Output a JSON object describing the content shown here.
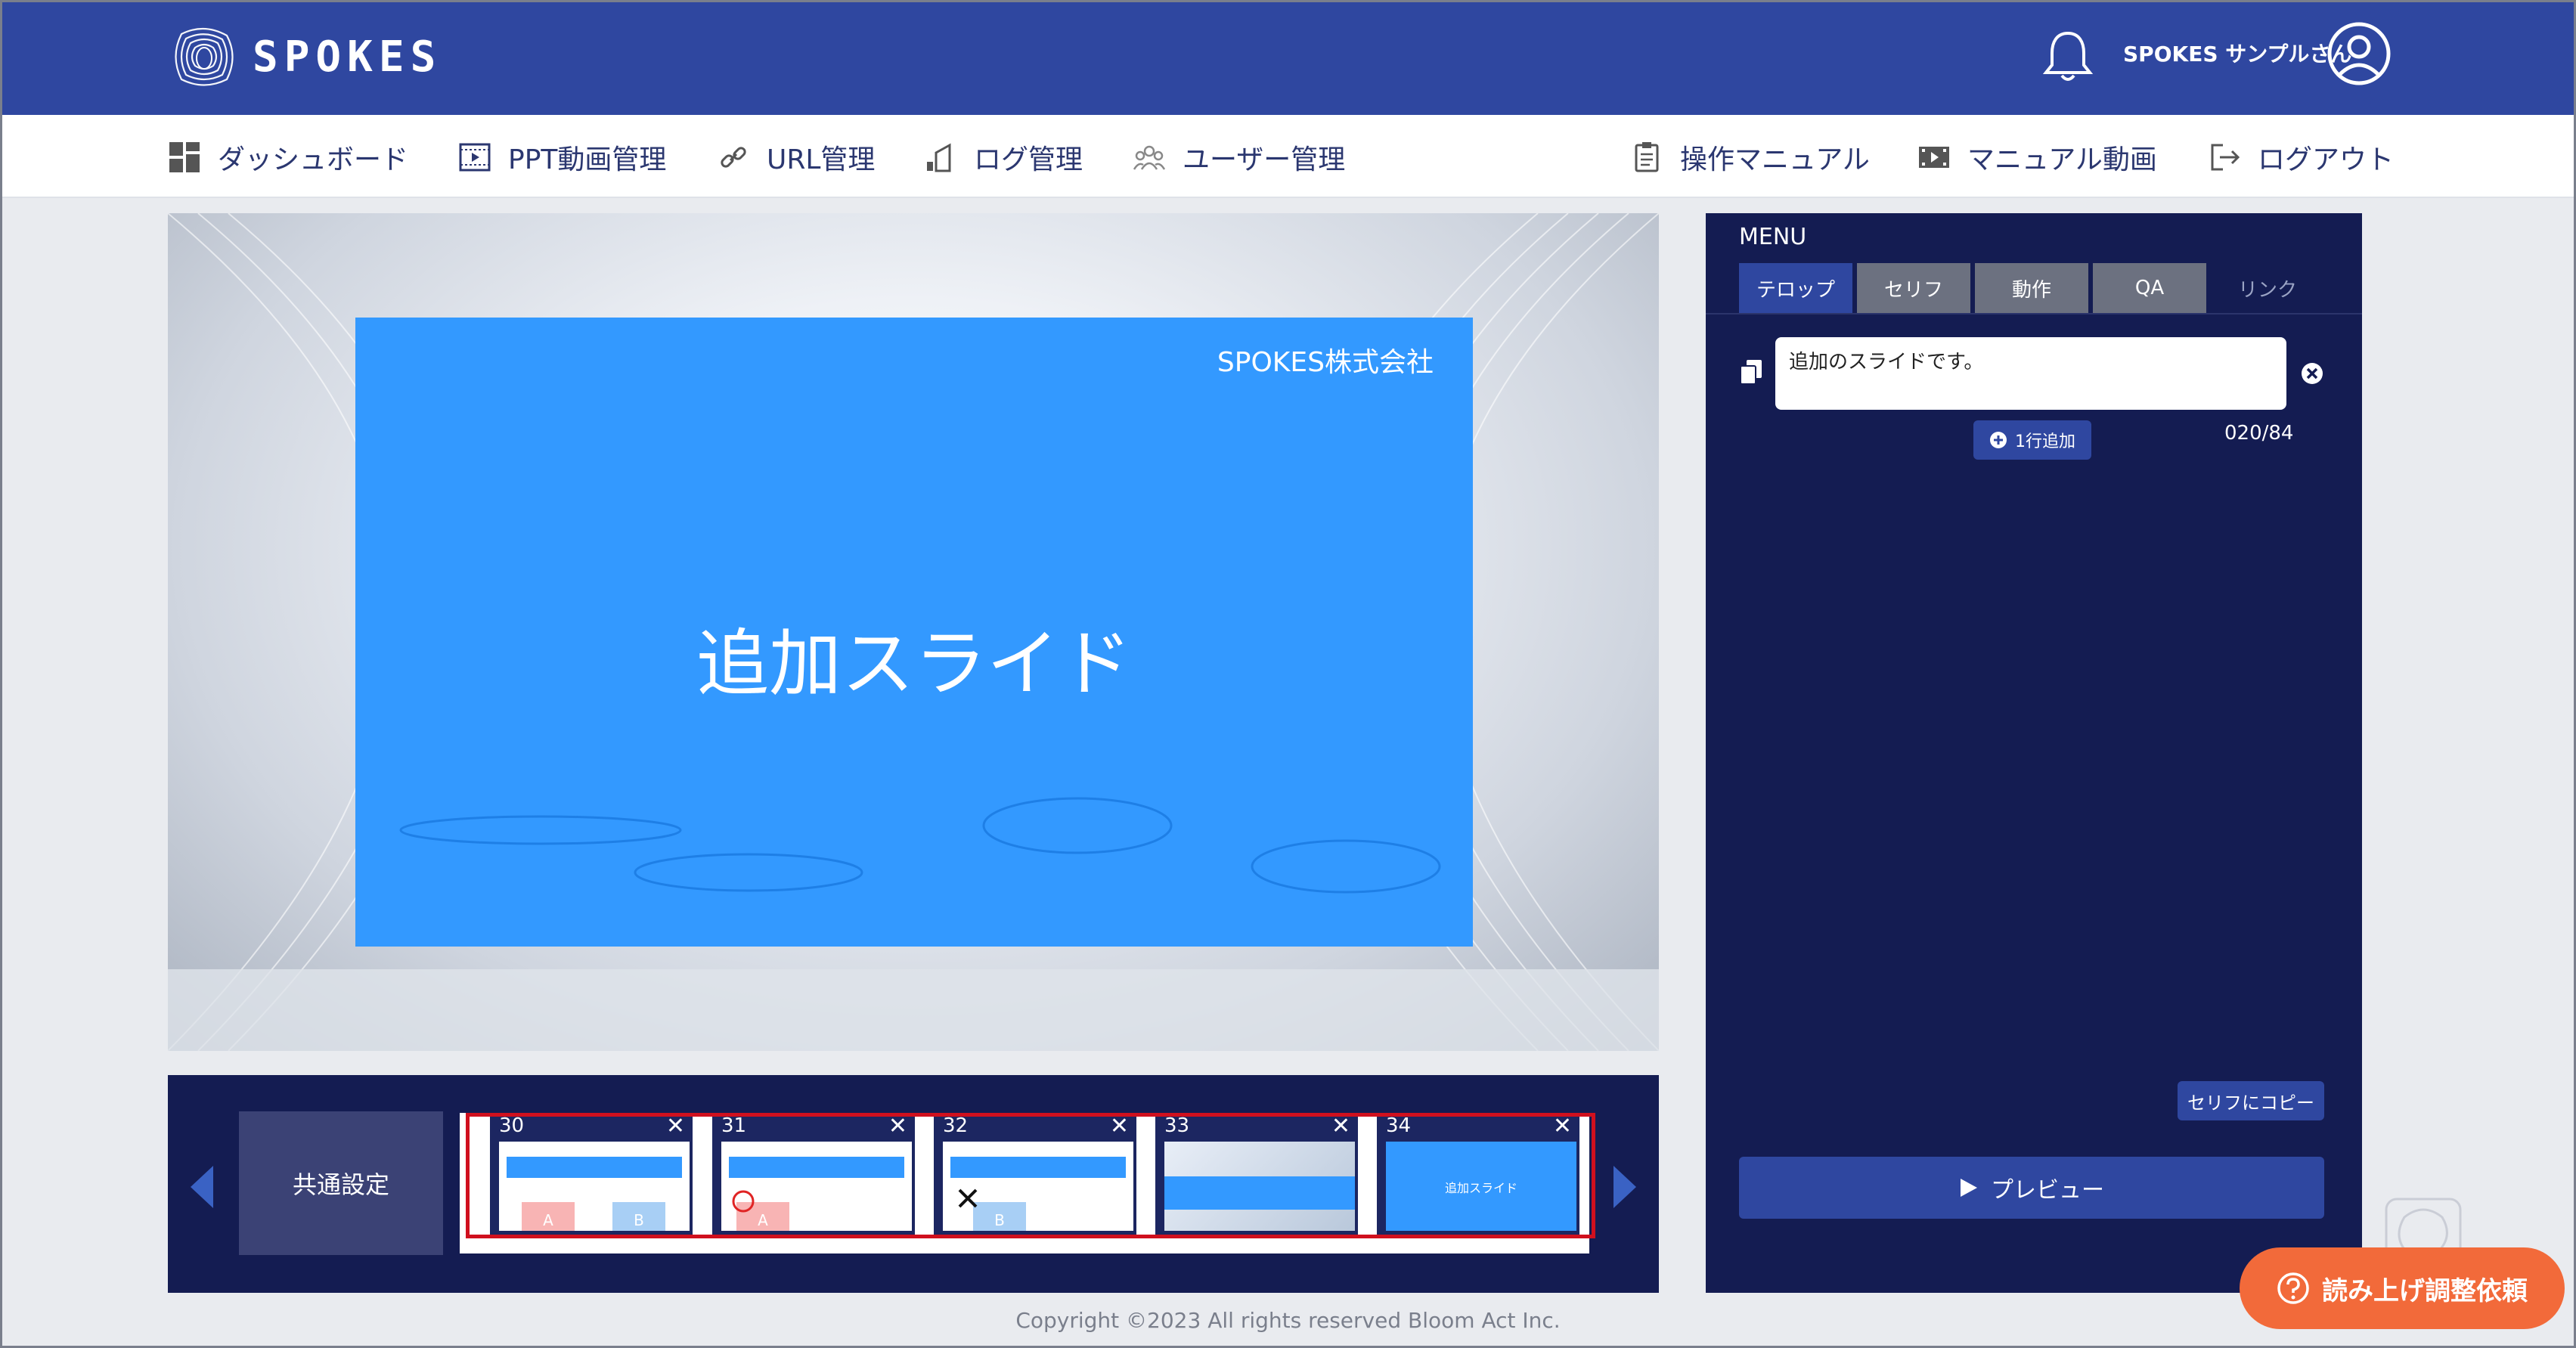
{
  "header": {
    "brand": "SPOKES",
    "user_name": "SPOKES サンプルさん"
  },
  "nav": {
    "dashboard": "ダッシュボード",
    "ppt_video": "PPT動画管理",
    "url": "URL管理",
    "log": "ログ管理",
    "users": "ユーザー管理",
    "manual": "操作マニュアル",
    "manual_video": "マニュアル動画",
    "logout": "ログアウト"
  },
  "slide": {
    "company": "SPOKES株式会社",
    "title": "追加スライド"
  },
  "filmstrip": {
    "common_settings": "共通設定",
    "thumbs": [
      {
        "num": "30",
        "close": "✕"
      },
      {
        "num": "31",
        "close": "✕"
      },
      {
        "num": "32",
        "close": "✕"
      },
      {
        "num": "33",
        "close": "✕"
      },
      {
        "num": "34",
        "close": "✕"
      }
    ],
    "thumb34_text": "追加スライド"
  },
  "panel": {
    "menu_label": "MENU",
    "tabs": [
      "テロップ",
      "セリフ",
      "動作",
      "QA",
      "リンク"
    ],
    "telop_value": "追加のスライドです。",
    "add_row": "1行追加",
    "counter": "020/84",
    "copy_to_serif": "セリフにコピー",
    "preview": "プレビュー"
  },
  "footer": {
    "copyright": "Copyright ©2023 All rights reserved Bloom Act Inc."
  },
  "request_button": "読み上げ調整依頼",
  "colors": {
    "header": "#2f47a0",
    "panel": "#141c52",
    "slide": "#3399ff",
    "accent_orange": "#f26a3a",
    "selection_red": "#d0101e"
  }
}
